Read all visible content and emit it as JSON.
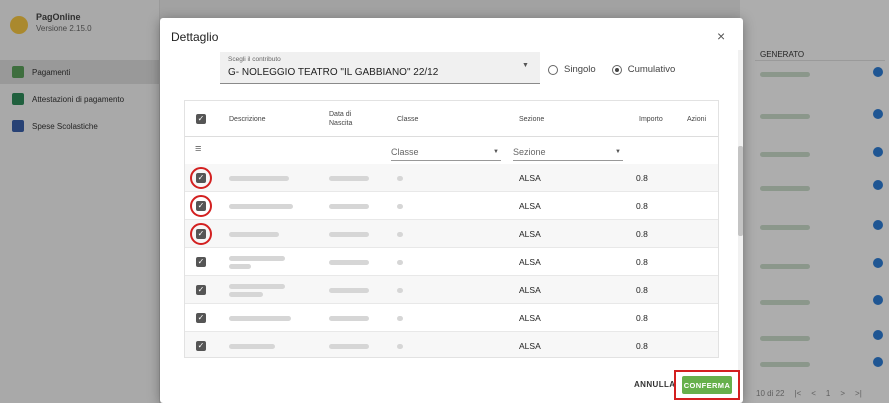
{
  "app": {
    "name": "PagOnline",
    "version": "Versione 2.15.0"
  },
  "sidebar": {
    "items": [
      {
        "label": "Pagamenti",
        "icon": "payments-icon"
      },
      {
        "label": "Attestazioni di pagamento",
        "icon": "certificate-icon"
      },
      {
        "label": "Spese Scolastiche",
        "icon": "school-icon"
      }
    ]
  },
  "background": {
    "column_header": "GENERATO",
    "pager": {
      "range": "10 di 22",
      "first": "|<",
      "prev": "<",
      "page": "1",
      "next": ">",
      "last": ">|"
    }
  },
  "dialog": {
    "title": "Dettaglio",
    "close": "×",
    "contributo": {
      "label": "Scegli il contributo",
      "value": "G- NOLEGGIO TEATRO \"IL GABBIANO\" 22/12"
    },
    "mode": {
      "options": [
        "Singolo",
        "Cumulativo"
      ],
      "selected": "Cumulativo"
    },
    "table": {
      "headers": {
        "descrizione": "Descrizione",
        "nascita": "Data di Nascita",
        "classe": "Classe",
        "sezione": "Sezione",
        "importo": "Importo",
        "azioni": "Azioni"
      },
      "filters": {
        "classe": "Classe",
        "sezione": "Sezione"
      },
      "rows": [
        {
          "sezione": "ALSA",
          "importo": "0.8",
          "highlighted": true
        },
        {
          "sezione": "ALSA",
          "importo": "0.8",
          "highlighted": true
        },
        {
          "sezione": "ALSA",
          "importo": "0.8",
          "highlighted": true
        },
        {
          "sezione": "ALSA",
          "importo": "0.8",
          "highlighted": false
        },
        {
          "sezione": "ALSA",
          "importo": "0.8",
          "highlighted": false
        },
        {
          "sezione": "ALSA",
          "importo": "0.8",
          "highlighted": false
        },
        {
          "sezione": "ALSA",
          "importo": "0.8",
          "highlighted": false
        }
      ]
    },
    "buttons": {
      "annulla": "ANNULLA",
      "conferma": "CONFERMA"
    }
  },
  "colors": {
    "accent_green": "#66b04b",
    "highlight_red": "#d32020",
    "info_blue": "#2d7bd3"
  }
}
